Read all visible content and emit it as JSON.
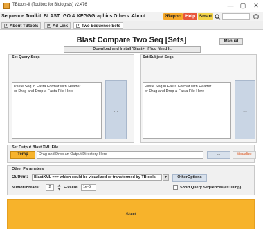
{
  "window": {
    "title": "TBtools-II (Toolbox for Biologists) v2.476",
    "minimize": "—",
    "maximize": "▢",
    "close": "✕"
  },
  "menubar": {
    "items": [
      "Sequence Toolkit",
      "BLAST",
      "GO & KEGG",
      "Graphics",
      "Others",
      "About"
    ],
    "report": "?Report",
    "help": "Help",
    "smart": "Smart",
    "search_icon": "search-icon",
    "settings_icon": "gear-icon"
  },
  "tabs": {
    "items": [
      {
        "label": "About TBtools"
      },
      {
        "label": "Ad Link"
      },
      {
        "label": "Two Sequence Sets"
      }
    ]
  },
  "main": {
    "title": "Blast Compare Two Seq [Sets]",
    "manual": "Manual",
    "download": "Download and Install 'Blast+' if You Need It."
  },
  "query": {
    "title": "Set Query Seqs",
    "text1": "Paste Seq in Fasta Format with Header",
    "text2": "or Drag and Drop a Fasta File Here",
    "button": "..."
  },
  "subject": {
    "title": "Set Subject Seqs",
    "text1": "Paste Seq in Fasta Format with Header",
    "text2": "or Drag and Drop a Fasta File Here",
    "button": "..."
  },
  "output": {
    "title": "Set Output Blast XML File",
    "temp": "Temp",
    "placeholder": "Drag and Drop an Output Directory Here",
    "browse": "...",
    "viewer": "Visualize"
  },
  "params": {
    "title": "Other Parameters",
    "outfmt_label": "OutFmt:",
    "outfmt_value": "BlastXML ==> which could be visualized or transformed by TBtools",
    "other_options": "OtherOptions",
    "threads_label": "NumofThreads:",
    "threads_value": "2",
    "evalue_label": "E-value:",
    "evalue_value": "1e-5",
    "short_query": "Short Query Sequences(<=100bp)"
  },
  "start": "Start",
  "colors": {
    "accent_orange": "#f7b32b",
    "button_blue": "#c9d5e4",
    "help_red": "#e8553b",
    "report_orange": "#f7a92a",
    "smart_yellow": "#f2d34a"
  }
}
